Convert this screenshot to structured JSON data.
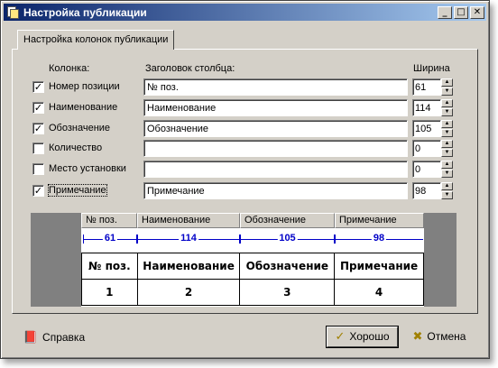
{
  "window": {
    "title": "Настройка публикации"
  },
  "titlebar_buttons": {
    "minimize": "_",
    "maximize": "□",
    "close": "✕"
  },
  "tab": {
    "label": "Настройка колонок публикации"
  },
  "headers": {
    "column": "Колонка:",
    "caption": "Заголовок столбца:",
    "width": "Ширина"
  },
  "rows": [
    {
      "checked": true,
      "check_mark": "✓",
      "label": "Номер позиции",
      "caption": "№ поз.",
      "width": "61"
    },
    {
      "checked": true,
      "check_mark": "✓",
      "label": "Наименование",
      "caption": "Наименование",
      "width": "114"
    },
    {
      "checked": true,
      "check_mark": "✓",
      "label": "Обозначение",
      "caption": "Обозначение",
      "width": "105"
    },
    {
      "checked": false,
      "check_mark": "",
      "label": "Количество",
      "caption": "",
      "width": "0"
    },
    {
      "checked": false,
      "check_mark": "",
      "label": "Место установки",
      "caption": "",
      "width": "0"
    },
    {
      "checked": true,
      "check_mark": "✓",
      "label": "Примечание",
      "caption": "Примечание",
      "width": "98"
    }
  ],
  "preview": {
    "column_headers": [
      "№ поз.",
      "Наименование",
      "Обозначение",
      "Примечание"
    ],
    "widths": [
      "61",
      "114",
      "105",
      "98"
    ],
    "table_header": [
      "№ поз.",
      "Наименование",
      "Обозначение",
      "Примечание"
    ],
    "table_numbers": [
      "1",
      "2",
      "3",
      "4"
    ]
  },
  "buttons": {
    "help": "Справка",
    "ok": "Хорошо",
    "cancel": "Отмена"
  },
  "colors": {
    "dimension_blue": "#0000c8",
    "title_start": "#0a246a",
    "title_end": "#a6caf0"
  }
}
